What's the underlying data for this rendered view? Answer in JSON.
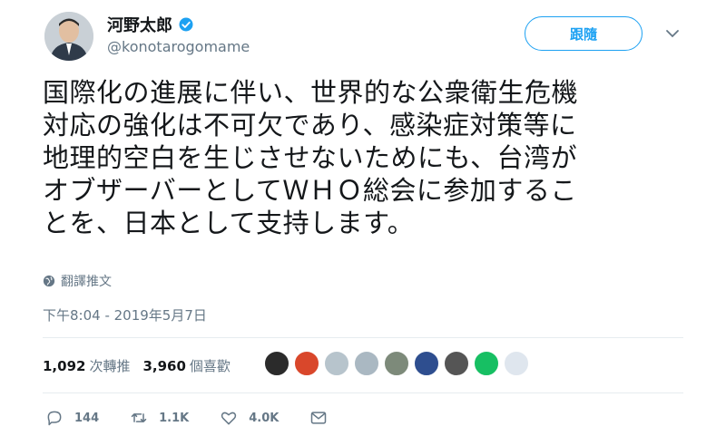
{
  "header": {
    "display_name": "河野太郎",
    "handle": "@konotarogomame",
    "follow_label": "跟隨"
  },
  "tweet": {
    "lines": [
      "国際化の進展に伴い、世界的な公衆衛生危機",
      "対応の強化は不可欠であり、感染症対策等に",
      "地理的空白を生じさせないためにも、台湾が",
      "オブザーバーとしてＷＨＯ総会に参加するこ",
      "とを、日本として支持します。"
    ],
    "translate_label": "翻譯推文",
    "timestamp": "下午8:04 - 2019年5月7日"
  },
  "stats": {
    "retweets_count": "1,092",
    "retweets_label": "次轉推",
    "likes_count": "3,960",
    "likes_label": "個喜歡"
  },
  "likers": [
    {
      "icon": "avatar-cat",
      "color": "#2b2b2b"
    },
    {
      "icon": "avatar-lantern",
      "color": "#d9472b"
    },
    {
      "icon": "avatar-aircraft",
      "color": "#b7c4cc"
    },
    {
      "icon": "avatar-default",
      "color": "#aab8c2"
    },
    {
      "icon": "avatar-person",
      "color": "#7d8a7a"
    },
    {
      "icon": "avatar-character",
      "color": "#2e4e8f"
    },
    {
      "icon": "avatar-cat-photo",
      "color": "#555555"
    },
    {
      "icon": "avatar-green",
      "color": "#17bf63"
    },
    {
      "icon": "avatar-badge",
      "color": "#dfe6ee"
    }
  ],
  "actions": {
    "reply_count": "144",
    "retweet_count": "1.1K",
    "like_count": "4.0K"
  },
  "colors": {
    "accent": "#1da1f2",
    "secondary_text": "#657786",
    "divider": "#e6ecf0"
  }
}
